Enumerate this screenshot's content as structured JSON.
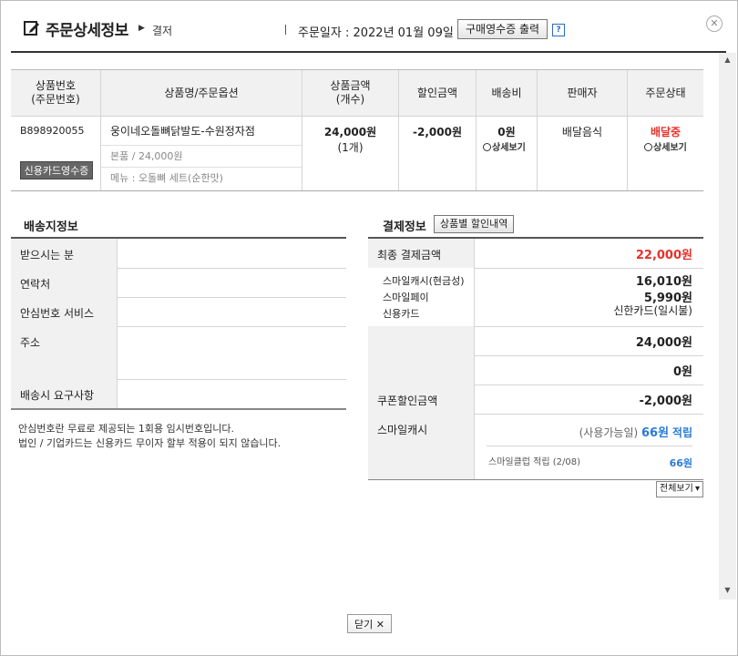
{
  "header": {
    "title": "주문상세정보",
    "crumb": "결저",
    "order_date": "주문일자 : 2022년 01월 09일",
    "print_button": "구매영수증 출력",
    "help_icon": "?",
    "close_icon": "✕"
  },
  "order_table": {
    "headers": [
      "상품번호\n(주문번호)",
      "상품명/주문옵션",
      "상품금액\n(개수)",
      "할인금액",
      "배송비",
      "판매자",
      "주문상태"
    ],
    "product_no": "B898920055",
    "product_name": "웅이네오돌뼈닭발도-수원정자점",
    "option_1": "본품 / 24,000원",
    "option_2": "메뉴 : 오돌뼈 세트(순한맛)",
    "card_receipt_button": "신용카드영수증",
    "price": "24,000원",
    "quantity": "(1개)",
    "discount": "-2,000원",
    "shipping_fee": "0원",
    "shipping_detail": "상세보기",
    "seller": "배달음식",
    "status": "배달중",
    "status_detail": "상세보기"
  },
  "delivery": {
    "title": "배송지정보",
    "rows": [
      {
        "label": "받으시는 분",
        "value": ""
      },
      {
        "label": "연락처",
        "value": ""
      },
      {
        "label": "안심번호 서비스",
        "value": ""
      },
      {
        "label": "주소",
        "value": ""
      },
      {
        "label": "배송시 요구사항",
        "value": ""
      }
    ],
    "note_1": "안심번호란 무료로 제공되는 1회용 임시번호입니다.",
    "note_2": "법인 / 기업카드는 신용카드 무이자 할부 적용이 되지 않습니다."
  },
  "payment": {
    "title": "결제정보",
    "discount_button": "상품별 할인내역",
    "final_label": "최종 결제금액",
    "final_value": "22,000원",
    "methods": [
      {
        "label": "스마일캐시(현금성)",
        "value": "16,010원"
      },
      {
        "label": "스마일페이",
        "value": "5,990원"
      },
      {
        "label": "신용카드",
        "value": "신한카드(일시불)"
      }
    ],
    "product_amount": "24,000원",
    "shipping_amount": "0원",
    "coupon_label": "쿠폰할인금액",
    "coupon_value": "-2,000원",
    "smilecash_label": "스마일캐시",
    "smilecash_available": "(사용가능일)",
    "smilecash_points": "66원",
    "smilecash_earn": "적립",
    "smileclub_label": "스마일클럽 적립 (2/08)",
    "smileclub_value": "66원",
    "view_select": "전체보기"
  },
  "footer": {
    "close_label": "닫기",
    "close_icon": "✕"
  }
}
